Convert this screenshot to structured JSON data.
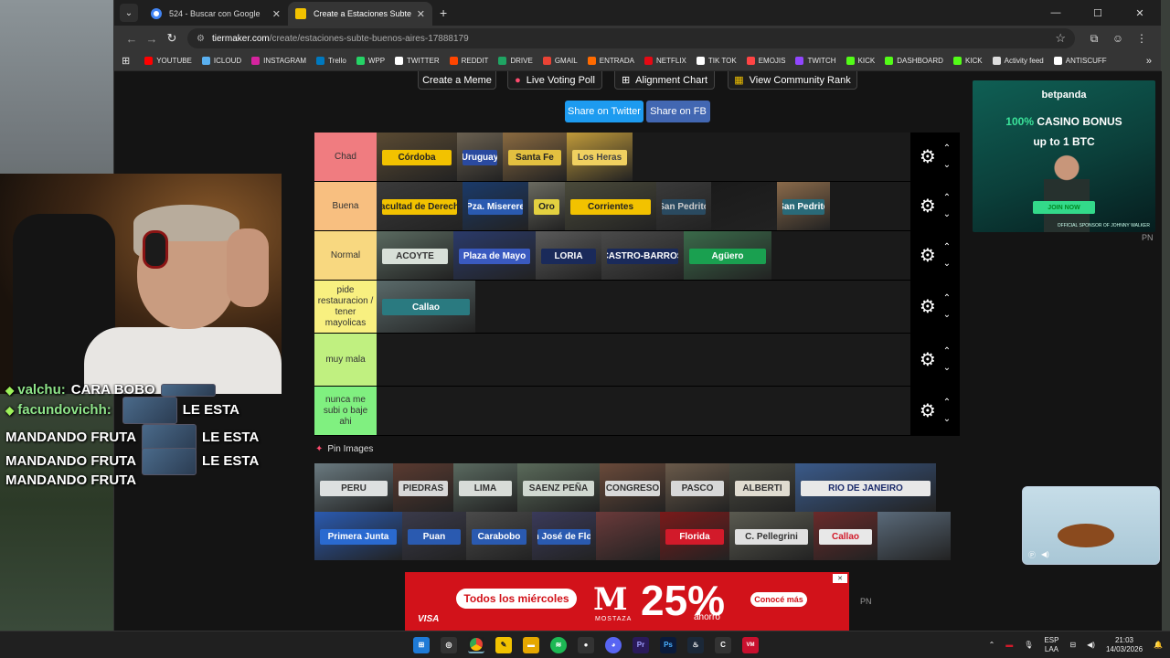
{
  "browser": {
    "tabs": [
      {
        "title": "524 - Buscar con Google",
        "favicon_color": "#4285f4",
        "active": false
      },
      {
        "title": "Create a Estaciones Subte Buen",
        "favicon_color": "#f2c200",
        "active": true
      }
    ],
    "url_host": "tiermaker.com",
    "url_path": "/create/estaciones-subte-buenos-aires-17888179",
    "bookmarks": [
      {
        "label": "YOUTUBE",
        "color": "#ff0000"
      },
      {
        "label": "ICLOUD",
        "color": "#5ab0f0"
      },
      {
        "label": "INSTAGRAM",
        "color": "#d6249f"
      },
      {
        "label": "Trello",
        "color": "#0079bf"
      },
      {
        "label": "WPP",
        "color": "#25d366"
      },
      {
        "label": "TWITTER",
        "color": "#ffffff"
      },
      {
        "label": "REDDIT",
        "color": "#ff4500"
      },
      {
        "label": "DRIVE",
        "color": "#1fa463"
      },
      {
        "label": "GMAIL",
        "color": "#ea4335"
      },
      {
        "label": "ENTRADA",
        "color": "#ff6a00"
      },
      {
        "label": "NETFLIX",
        "color": "#e50914"
      },
      {
        "label": "TIK TOK",
        "color": "#ffffff"
      },
      {
        "label": "EMOJIS",
        "color": "#ff4444"
      },
      {
        "label": "TWITCH",
        "color": "#9146ff"
      },
      {
        "label": "KICK",
        "color": "#53fc18"
      },
      {
        "label": "DASHBOARD",
        "color": "#53fc18"
      },
      {
        "label": "KICK",
        "color": "#53fc18"
      },
      {
        "label": "Activity feed",
        "color": "#dddddd"
      },
      {
        "label": "ANTISCUFF",
        "color": "#ffffff"
      }
    ]
  },
  "page": {
    "top_buttons": [
      "Create a Meme",
      "Live Voting Poll",
      "Alignment Chart",
      "View Community Rank"
    ],
    "share_twitter": "Share on Twitter",
    "share_fb": "Share on FB",
    "pin_label": "Pin Images"
  },
  "tiers": [
    {
      "label": "Chad",
      "color": "#f07c80",
      "items": [
        {
          "text": "Córdoba",
          "bg": "#5a4a32",
          "plate": "#f2c200",
          "ink": "#222",
          "w": 88
        },
        {
          "text": "Uruguay",
          "bg": "#6a6050",
          "plate": "#2a4aa0",
          "ink": "#fff",
          "w": 50
        },
        {
          "text": "Santa Fe",
          "bg": "#8a6a40",
          "plate": "#e3c040",
          "ink": "#222",
          "w": 70
        },
        {
          "text": "Los Heras",
          "bg": "#c09a3a",
          "plate": "#f0d060",
          "ink": "#444",
          "w": 72
        }
      ]
    },
    {
      "label": "Buena",
      "color": "#f8bf80",
      "items": [
        {
          "text": "Facultad de Derecho",
          "bg": "#3a3a3a",
          "plate": "#f2c200",
          "ink": "#222",
          "w": 94
        },
        {
          "text": "Pza. Miserere",
          "bg": "#1a3a6a",
          "plate": "#2a5ab0",
          "ink": "#fff",
          "w": 72
        },
        {
          "text": "Oro",
          "bg": "#6a6a60",
          "plate": "#e3d040",
          "ink": "#222",
          "w": 40
        },
        {
          "text": "Corrientes",
          "bg": "#4a4a3a",
          "plate": "#f2c200",
          "ink": "#222",
          "w": 100
        },
        {
          "text": "San Pedrito",
          "bg": "#3a3a3a",
          "plate": "#2a4a60",
          "ink": "#ccc",
          "w": 60
        },
        {
          "text": "",
          "bg": "#1a1a1a",
          "plate": "#1a1a1a",
          "ink": "#1a1a1a",
          "w": 72
        },
        {
          "text": "San Pedrito",
          "bg": "#8a6a4a",
          "plate": "#2a6a78",
          "ink": "#fff",
          "w": 58
        }
      ]
    },
    {
      "label": "Normal",
      "color": "#f8d880",
      "items": [
        {
          "text": "ACOYTE",
          "bg": "#5a6a60",
          "plate": "#d8e0d8",
          "ink": "#333",
          "w": 84
        },
        {
          "text": "Plaza de Mayo",
          "bg": "#2a3a6a",
          "plate": "#3a5ac0",
          "ink": "#fff",
          "w": 90
        },
        {
          "text": "LORIA",
          "bg": "#5a5a5a",
          "plate": "#1a2a5a",
          "ink": "#fff",
          "w": 72
        },
        {
          "text": "CASTRO-BARROS",
          "bg": "#4a4a4a",
          "plate": "#1a2a5a",
          "ink": "#fff",
          "w": 90
        },
        {
          "text": "Agüero",
          "bg": "#3a6a4a",
          "plate": "#1aa050",
          "ink": "#fff",
          "w": 96
        }
      ]
    },
    {
      "label": "pide restauracion / tener mayolicas",
      "color": "#f8f080",
      "items": [
        {
          "text": "Callao",
          "bg": "#5a6a6a",
          "plate": "#2a7a80",
          "ink": "#fff",
          "w": 108
        }
      ]
    },
    {
      "label": "muy mala",
      "color": "#c0f080",
      "items": []
    },
    {
      "label": "nunca me subi o baje ahi",
      "color": "#80f080",
      "items": []
    }
  ],
  "pin_rows": [
    [
      {
        "text": "PERU",
        "bg": "#6a7a80",
        "plate": "#dde0e0",
        "ink": "#333",
        "w": 86
      },
      {
        "text": "PIEDRAS",
        "bg": "#5a3a30",
        "plate": "#d8d8d8",
        "ink": "#333",
        "w": 66
      },
      {
        "text": "LIMA",
        "bg": "#5a6a60",
        "plate": "#d8dcd8",
        "ink": "#333",
        "w": 70
      },
      {
        "text": "SAENZ PEÑA",
        "bg": "#5a6a5a",
        "plate": "#d0d8d0",
        "ink": "#333",
        "w": 90
      },
      {
        "text": "CONGRESO",
        "bg": "#6a4a3a",
        "plate": "#d8d8d8",
        "ink": "#333",
        "w": 72
      },
      {
        "text": "PASCO",
        "bg": "#6a5a4a",
        "plate": "#d8d8d8",
        "ink": "#333",
        "w": 70
      },
      {
        "text": "ALBERTI",
        "bg": "#4a4a40",
        "plate": "#e0dcd0",
        "ink": "#333",
        "w": 72
      },
      {
        "text": "RIO DE JANEIRO",
        "bg": "#3a5a8a",
        "plate": "#e8e8e8",
        "ink": "#1a2a6a",
        "w": 154
      }
    ],
    [
      {
        "text": "Primera Junta",
        "bg": "#2a5ab0",
        "plate": "#2a6ad0",
        "ink": "#fff",
        "w": 96
      },
      {
        "text": "Puan",
        "bg": "#3a3a4a",
        "plate": "#2a5ab0",
        "ink": "#fff",
        "w": 70
      },
      {
        "text": "Carabobo",
        "bg": "#4a4a4a",
        "plate": "#2a5ab0",
        "ink": "#fff",
        "w": 72
      },
      {
        "text": "San José de Flores",
        "bg": "#3a3a5a",
        "plate": "#2a5ab0",
        "ink": "#fff",
        "w": 70
      },
      {
        "text": "",
        "bg": "#6a3a3a",
        "plate": "#6a3a3a",
        "ink": "#6a3a3a",
        "w": 70
      },
      {
        "text": "Florida",
        "bg": "#7a1a1a",
        "plate": "#d21a2a",
        "ink": "#fff",
        "w": 76
      },
      {
        "text": "C. Pellegrini",
        "bg": "#5a5a50",
        "plate": "#e0e0e0",
        "ink": "#333",
        "w": 92
      },
      {
        "text": "Callao",
        "bg": "#6a2a2a",
        "plate": "#e8e8e8",
        "ink": "#d21a2a",
        "w": 70
      },
      {
        "text": "",
        "bg": "#5a6a7a",
        "plate": "#5a6a7a",
        "ink": "#5a6a7a",
        "w": 80
      }
    ]
  ],
  "chat": [
    {
      "user": "valchu:",
      "message": "CARA BOBO"
    },
    {
      "user": "facundovichh:",
      "message": "LE ESTA"
    },
    {
      "user": "",
      "message": "MANDANDO FRUTA"
    },
    {
      "user": "",
      "message": "LE ESTA"
    },
    {
      "user": "",
      "message": "MANDANDO FRUTA"
    },
    {
      "user": "",
      "message": "LE ESTA"
    },
    {
      "user": "",
      "message": "MANDANDO FRUTA"
    }
  ],
  "ads": {
    "right_brand": "betpanda",
    "right_headline_green": "100%",
    "right_headline_rest": " CASINO BONUS",
    "right_sub": "up to 1 BTC",
    "right_cta": "JOIN NOW",
    "right_sponsor": "OFFICIAL SPONSOR OF JOHNNY WALKER",
    "pn": "PN",
    "bottom_pill": "Todos los miércoles",
    "bottom_logo": "M",
    "bottom_name": "MOSTAZA",
    "bottom_pct": "25%",
    "bottom_ahorro": "ahorro",
    "bottom_cta": "Conocé más",
    "bottom_visa": "VISA"
  },
  "system": {
    "lang_top": "ESP",
    "lang_bottom": "LAA",
    "time": "21:03",
    "date": "14/03/2026"
  }
}
